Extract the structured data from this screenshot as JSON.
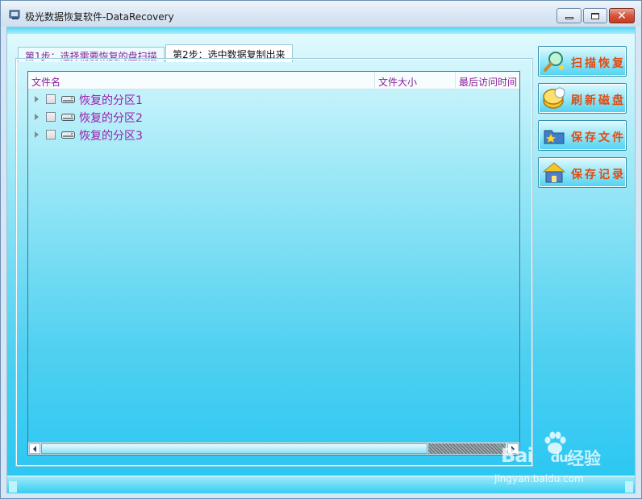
{
  "window": {
    "title": "极光数据恢复软件-DataRecovery",
    "icon": "app-icon",
    "controls": {
      "minimize_icon": "minimize-icon",
      "maximize_icon": "maximize-icon",
      "close_icon": "close-icon",
      "close_glyph": "✕"
    }
  },
  "tabs": [
    {
      "label": "第1步：选择需要恢复的盘扫描",
      "active": false
    },
    {
      "label": "第2步：选中数据复制出来",
      "active": true
    }
  ],
  "tree": {
    "columns": [
      "文件名",
      "文件大小",
      "最后访问时间"
    ],
    "rows": [
      {
        "label": "恢复的分区1",
        "checked": false,
        "icon": "drive-icon"
      },
      {
        "label": "恢复的分区2",
        "checked": false,
        "icon": "drive-icon"
      },
      {
        "label": "恢复的分区3",
        "checked": false,
        "icon": "drive-icon"
      }
    ]
  },
  "side_buttons": [
    {
      "label": "扫描恢复",
      "icon": "magnifier-icon"
    },
    {
      "label": "刷新磁盘",
      "icon": "refresh-disk-icon"
    },
    {
      "label": "保存文件",
      "icon": "folder-star-icon"
    },
    {
      "label": "保存记录",
      "icon": "house-icon"
    }
  ],
  "watermark": {
    "brand": "Bai",
    "brand_suffix": "du",
    "chinese": "经验",
    "url": "jingyan.baidu.com"
  },
  "colors": {
    "accent_text": "#9a1fb0",
    "button_text": "#e34b12",
    "panel_gradient_top": "#e4fafd",
    "panel_gradient_bottom": "#27c6f2"
  }
}
